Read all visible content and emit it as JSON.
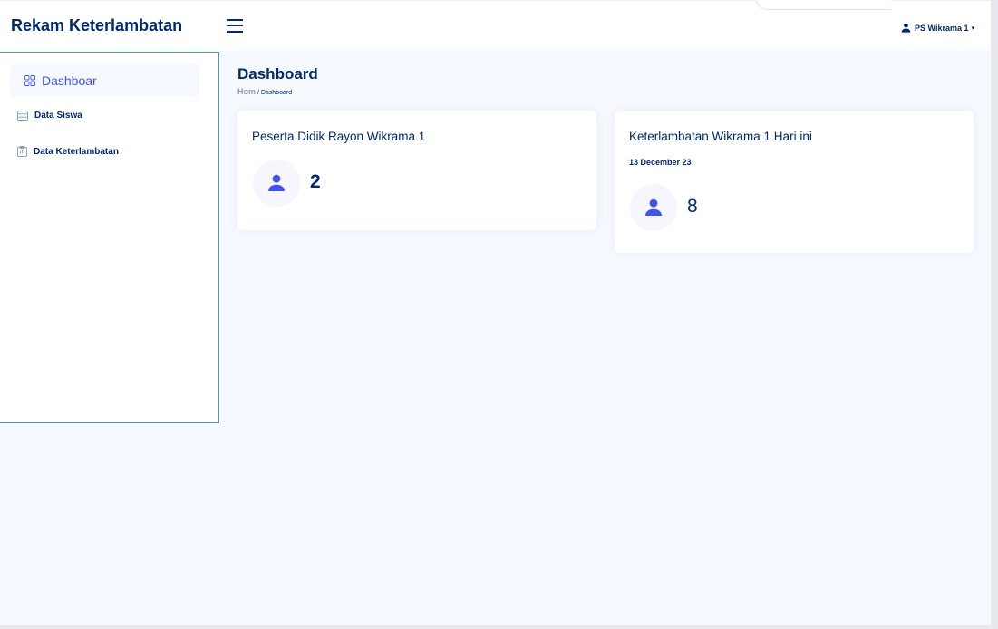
{
  "header": {
    "brand": "Rekam Keterlambatan",
    "user": "PS Wikrama 1"
  },
  "sidebar": {
    "items": [
      {
        "label": "Dashboar",
        "icon": "grid-icon",
        "active": true
      },
      {
        "label": "Data Siswa",
        "icon": "table-icon",
        "active": false
      },
      {
        "label": "Data Keterlambatan",
        "icon": "clipboard-icon",
        "active": false
      }
    ]
  },
  "main": {
    "title": "Dashboard",
    "breadcrumb": {
      "home": "Hom",
      "current": "/ Dashboard"
    },
    "cards": [
      {
        "title": "Peserta Didik Rayon Wikrama 1",
        "value": "2"
      },
      {
        "title": "Keterlambatan Wikrama 1 Hari ini",
        "date": "13 December 23",
        "value": "8"
      }
    ]
  },
  "colors": {
    "primary": "#012970",
    "accent": "#4154f1",
    "background": "#f6f9ff",
    "sidebar_border": "#3aa6b9"
  }
}
